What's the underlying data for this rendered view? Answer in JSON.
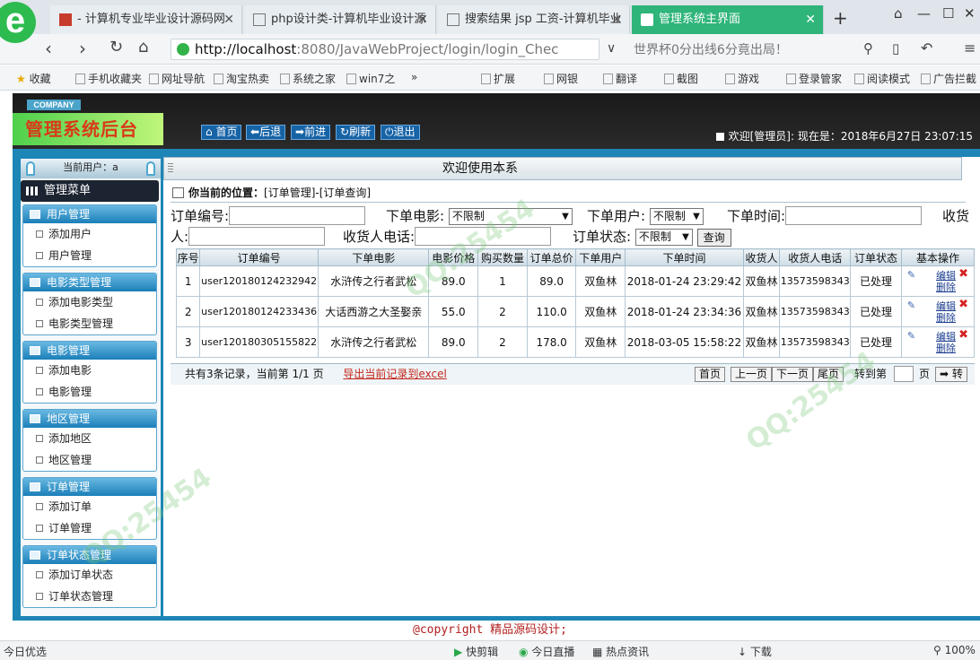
{
  "browser": {
    "tabs": [
      {
        "title": "- 计算机专业毕业设计源码网"
      },
      {
        "title": "php设计类-计算机毕业设计源"
      },
      {
        "title": "搜索结果 jsp 工资-计算机毕业"
      },
      {
        "title": "管理系统主界面"
      }
    ],
    "url_host": "http://localhost",
    "url_rest": ":8080/JavaWebProject/login/login_Chec",
    "news": "世界杯0分出线6分竟出局！",
    "favorites": [
      "收藏",
      "手机收藏夹",
      "网址导航",
      "淘宝热卖",
      "系统之家",
      "win7之",
      "扩展",
      "网银",
      "翻译",
      "截图",
      "游戏",
      "登录管家",
      "阅读模式",
      "广告拦截"
    ]
  },
  "header": {
    "company": "COMPANY",
    "title": "管理系统后台",
    "buttons": [
      "首页",
      "后退",
      "前进",
      "刷新",
      "退出"
    ],
    "welcome": "欢迎[管理员]:   现在是：2018年6月27日 23:07:15"
  },
  "sidebar": {
    "current_user": "当前用户：a",
    "menu_title": "管理菜单",
    "groups": [
      {
        "title": "用户管理",
        "items": [
          "添加用户",
          "用户管理"
        ]
      },
      {
        "title": "电影类型管理",
        "items": [
          "添加电影类型",
          "电影类型管理"
        ]
      },
      {
        "title": "电影管理",
        "items": [
          "添加电影",
          "电影管理"
        ]
      },
      {
        "title": "地区管理",
        "items": [
          "添加地区",
          "地区管理"
        ]
      },
      {
        "title": "订单管理",
        "items": [
          "添加订单",
          "订单管理"
        ]
      },
      {
        "title": "订单状态管理",
        "items": [
          "添加订单状态",
          "订单状态管理"
        ]
      }
    ]
  },
  "main": {
    "welcome": "欢迎使用本系",
    "location_label": "你当前的位置：",
    "location": "[订单管理]-[订单查询]",
    "search": {
      "order_no": "订单编号:",
      "movie": "下单电影:",
      "movie_value": "不限制",
      "user": "下单用户:",
      "user_value": "不限制",
      "time": "下单时间:",
      "receiver_a": "收货",
      "receiver_b": "人:",
      "phone": "收货人电话:",
      "status": "订单状态:",
      "status_value": "不限制",
      "query": "查询"
    },
    "table": {
      "headers": [
        "序号",
        "订单编号",
        "下单电影",
        "电影价格",
        "购买数量",
        "订单总价",
        "下单用户",
        "下单时间",
        "收货人",
        "收货人电话",
        "订单状态",
        "基本操作"
      ],
      "rows": [
        [
          "1",
          "user120180124232942",
          "水浒传之行者武松",
          "89.0",
          "1",
          "89.0",
          "双鱼林",
          "2018-01-24 23:29:42",
          "双鱼林",
          "13573598343",
          "已处理"
        ],
        [
          "2",
          "user120180124233436",
          "大话西游之大圣娶亲",
          "55.0",
          "2",
          "110.0",
          "双鱼林",
          "2018-01-24 23:34:36",
          "双鱼林",
          "13573598343",
          "已处理"
        ],
        [
          "3",
          "user120180305155822",
          "水浒传之行者武松",
          "89.0",
          "2",
          "178.0",
          "双鱼林",
          "2018-03-05 15:58:22",
          "双鱼林",
          "13573598343",
          "已处理"
        ]
      ],
      "edit": "编辑",
      "delete": "删除"
    },
    "pager": {
      "summary": "共有3条记录，当前第 1/1 页",
      "export": "导出当前记录到excel",
      "first": "首页",
      "prev": "上一页",
      "next": "下一页",
      "last": "尾页",
      "goto": "转到第",
      "page": "页",
      "go": "转"
    }
  },
  "footer": "@copyright 精品源码设计;",
  "status": [
    "今日优选",
    "快剪辑",
    "今日直播",
    "热点资讯",
    "下载",
    "100%"
  ],
  "watermarks": [
    "QQ:25454"
  ]
}
